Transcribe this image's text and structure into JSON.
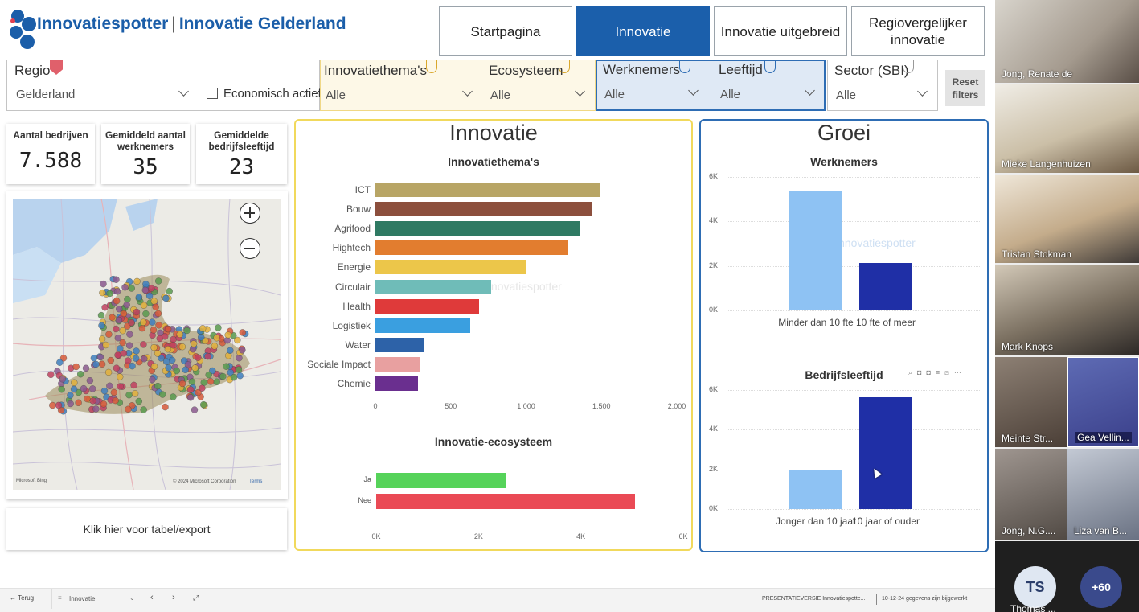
{
  "header": {
    "brand": "Innovatiespotter",
    "separator": "|",
    "subtitle": "Innovatie Gelderland",
    "nav": [
      "Startpagina",
      "Innovatie",
      "Innovatie uitgebreid",
      "Regiovergelijker innovatie"
    ],
    "active_nav": "Innovatie"
  },
  "filters": {
    "regio": {
      "label": "Regio",
      "value": "Gelderland"
    },
    "economisch_actief": "Economisch actief",
    "thema": {
      "label": "Innovatiethema's",
      "value": "Alle"
    },
    "ecosysteem": {
      "label": "Ecosysteem",
      "value": "Alle"
    },
    "werknemers": {
      "label": "Werknemers",
      "value": "Alle"
    },
    "leeftijd": {
      "label": "Leeftijd",
      "value": "Alle"
    },
    "sector": {
      "label": "Sector (SBI)",
      "value": "Alle"
    },
    "reset": "Reset filters"
  },
  "kpis": [
    {
      "label": "Aantal bedrijven",
      "value": "7.588"
    },
    {
      "label": "Gemiddeld aantal werknemers",
      "value": "35"
    },
    {
      "label": "Gemiddelde bedrijfsleeftijd",
      "value": "23"
    }
  ],
  "map": {
    "credit_left": "Microsoft Bing",
    "credit_right": "© 2024 Microsoft Corporation",
    "terms": "Terms"
  },
  "export_button": "Klik hier voor tabel/export",
  "innovatie_panel": {
    "title": "Innovatie",
    "watermark": "innovatiespotter"
  },
  "groei_panel": {
    "title": "Groei",
    "watermark": "innovatiespotter"
  },
  "chart_data": [
    {
      "type": "bar",
      "orientation": "horizontal",
      "title": "Innovatiethema's",
      "categories": [
        "ICT",
        "Bouw",
        "Agrifood",
        "Hightech",
        "Energie",
        "Circulair",
        "Health",
        "Logistiek",
        "Water",
        "Sociale Impact",
        "Chemie"
      ],
      "values": [
        1490,
        1440,
        1360,
        1280,
        1000,
        770,
        690,
        630,
        320,
        300,
        280
      ],
      "colors": [
        "#b8a565",
        "#8c4f3d",
        "#2f7a63",
        "#e27d2f",
        "#ecc64a",
        "#6fbcb8",
        "#df3a3a",
        "#3a9fe0",
        "#2d62a8",
        "#e8a0a0",
        "#6a2f8f"
      ],
      "xticks": [
        "0",
        "500",
        "1.000",
        "1.500",
        "2.000"
      ],
      "xlim": [
        0,
        2000
      ]
    },
    {
      "type": "bar",
      "orientation": "horizontal",
      "title": "Innovatie-ecosysteem",
      "categories": [
        "Ja",
        "Nee"
      ],
      "values": [
        2550,
        5050
      ],
      "colors": [
        "#56d35a",
        "#ea4a55"
      ],
      "xticks": [
        "0K",
        "2K",
        "4K",
        "6K"
      ],
      "xlim": [
        0,
        6000
      ]
    },
    {
      "type": "bar",
      "title": "Werknemers",
      "categories": [
        "Minder dan 10 fte",
        "10 fte of meer"
      ],
      "values": [
        5400,
        2150
      ],
      "colors": [
        "#8ec2f3",
        "#1f2fa6"
      ],
      "yticks": [
        "6K",
        "4K",
        "2K",
        "0K"
      ],
      "ylim": [
        0,
        6000
      ]
    },
    {
      "type": "bar",
      "title": "Bedrijfsleeftijd",
      "categories": [
        "Jonger dan 10 jaar",
        "10 jaar of ouder"
      ],
      "values": [
        1950,
        5650
      ],
      "colors": [
        "#8ec2f3",
        "#1f2fa6"
      ],
      "yticks": [
        "6K",
        "4K",
        "2K",
        "0K"
      ],
      "ylim": [
        0,
        6000
      ]
    }
  ],
  "bottom_bar": {
    "back": "Terug",
    "page": "Innovatie",
    "version": "PRESENTATIEVERSIE Innovatiespotte...",
    "updated": "10-12-24 gegevens zijn bijgewerkt"
  },
  "participants": [
    "Jong, Renate de",
    "Mieke Langenhuizen",
    "Tristan Stokman",
    "Mark Knops",
    "Meinte Str...",
    "Gea Vellin...",
    "Jong, N.G....",
    "Liza van B...",
    "Thomas ..."
  ],
  "avatar_initials": "TS",
  "more_count": "+60"
}
